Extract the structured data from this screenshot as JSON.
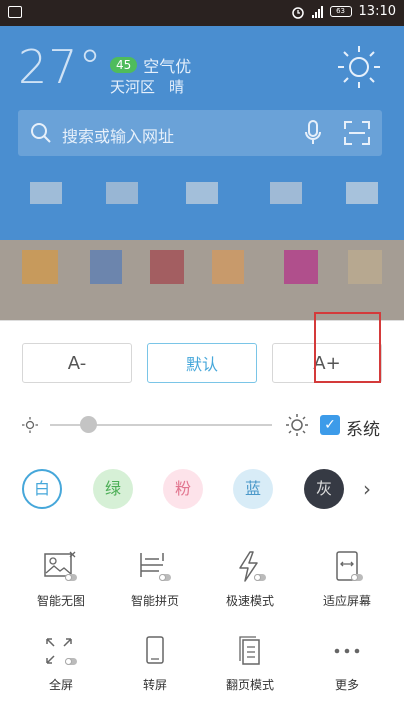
{
  "status_bar": {
    "time": "13:10",
    "battery": "63"
  },
  "weather": {
    "temperature": "27°",
    "aqi_value": "45",
    "aqi_label": "空气优",
    "district": "天河区",
    "condition": "晴"
  },
  "search": {
    "placeholder": "搜索或输入网址"
  },
  "font_size": {
    "decrease": "A-",
    "default": "默认",
    "increase": "A+"
  },
  "brightness": {
    "system_label": "系统",
    "system_checked": true,
    "level": 0.17
  },
  "themes": [
    {
      "label": "白",
      "bg": "#ffffff",
      "color": "#46a7da"
    },
    {
      "label": "绿",
      "bg": "#d6f0d6",
      "color": "#4cae56"
    },
    {
      "label": "粉",
      "bg": "#fde3ea",
      "color": "#e2758f"
    },
    {
      "label": "蓝",
      "bg": "#d8ecf7",
      "color": "#4a98c9"
    },
    {
      "label": "灰",
      "bg": "#363a44",
      "color": "#dddddd"
    }
  ],
  "tools": [
    {
      "label": "智能无图",
      "icon": "no-image-icon"
    },
    {
      "label": "智能拼页",
      "icon": "page-merge-icon"
    },
    {
      "label": "极速模式",
      "icon": "lightning-icon"
    },
    {
      "label": "适应屏幕",
      "icon": "fit-screen-icon"
    },
    {
      "label": "全屏",
      "icon": "fullscreen-icon"
    },
    {
      "label": "转屏",
      "icon": "rotate-screen-icon"
    },
    {
      "label": "翻页模式",
      "icon": "page-flip-icon"
    },
    {
      "label": "更多",
      "icon": "more-dots-icon"
    }
  ],
  "colors": {
    "accent": "#46a7da",
    "header_blue": "#4a8ed0",
    "highlight_red": "#d43a3a"
  }
}
